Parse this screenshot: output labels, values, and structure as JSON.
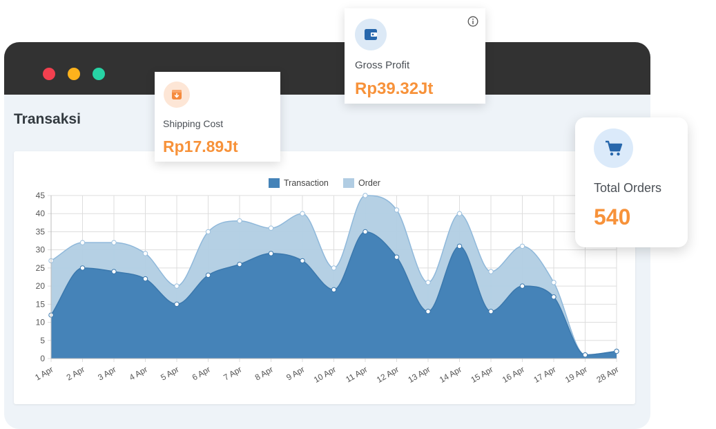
{
  "page": {
    "title": "Transaksi"
  },
  "cards": {
    "shipping": {
      "label": "Shipping Cost",
      "value": "Rp17.89Jt",
      "icon": "box-icon"
    },
    "gross": {
      "label": "Gross Profit",
      "value": "Rp39.32Jt",
      "icon": "wallet-icon",
      "info_icon": "info-icon"
    },
    "orders": {
      "label": "Total Orders",
      "value": "540",
      "icon": "cart-icon"
    }
  },
  "window_controls": [
    "close-dot",
    "minimize-dot",
    "maximize-dot"
  ],
  "colors": {
    "transaction": "#4583b8",
    "order": "#b1cde3",
    "accent_value": "#f7923a",
    "titlebar": "#323232"
  },
  "chart_data": {
    "type": "area",
    "categories": [
      "1 Apr",
      "2 Apr",
      "3 Apr",
      "4 Apr",
      "5 Apr",
      "6 Apr",
      "7 Apr",
      "8 Apr",
      "9 Apr",
      "10 Apr",
      "11 Apr",
      "12 Apr",
      "13 Apr",
      "14 Apr",
      "15 Apr",
      "16 Apr",
      "17 Apr",
      "19 Apr",
      "28 Apr"
    ],
    "series": [
      {
        "name": "Transaction",
        "values": [
          12,
          25,
          24,
          22,
          15,
          23,
          26,
          29,
          27,
          19,
          35,
          28,
          13,
          31,
          13,
          20,
          17,
          1,
          2
        ]
      },
      {
        "name": "Order",
        "values": [
          27,
          32,
          32,
          29,
          20,
          35,
          38,
          36,
          40,
          25,
          45,
          41,
          21,
          40,
          24,
          31,
          21,
          1,
          2
        ]
      }
    ],
    "ylim": [
      0,
      45
    ],
    "yticks": [
      0,
      5,
      10,
      15,
      20,
      25,
      30,
      35,
      40,
      45
    ],
    "grid": true,
    "legend": "top-center",
    "smooth": true
  }
}
